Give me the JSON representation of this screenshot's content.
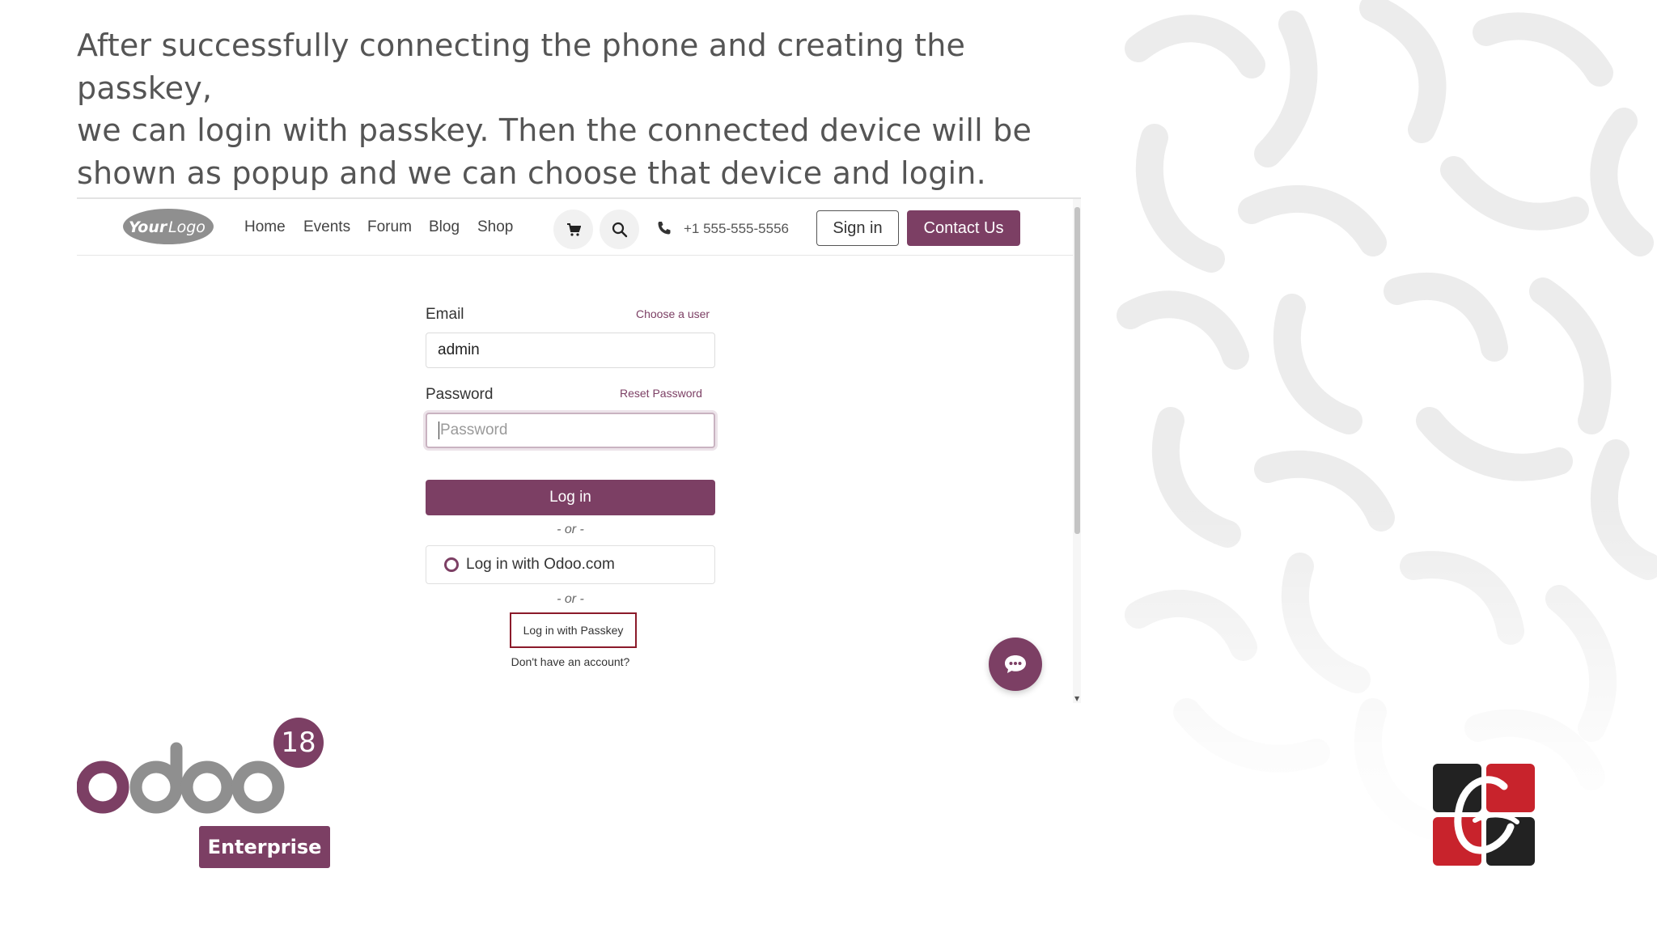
{
  "headline": {
    "line1": "After successfully connecting the phone and creating the passkey,",
    "line2": "we can login with passkey. Then the connected device will be",
    "line3": "shown as popup and we can choose that device and login."
  },
  "navbar": {
    "logo": "YourLogo",
    "links": [
      "Home",
      "Events",
      "Forum",
      "Blog",
      "Shop"
    ],
    "cart_icon": "cart-icon",
    "search_icon": "search-icon",
    "phone_icon": "phone-icon",
    "phone": "+1 555-555-5556",
    "sign_in": "Sign in",
    "contact": "Contact Us"
  },
  "login_form": {
    "email_label": "Email",
    "choose_user": "Choose a user",
    "email_value": "admin",
    "password_label": "Password",
    "reset_password": "Reset Password",
    "password_placeholder": "Password",
    "login_button": "Log in",
    "or_separator": "- or -",
    "odoo_login": "Log in with Odoo.com",
    "passkey_login": "Log in with Passkey",
    "signup": "Don't have an account?"
  },
  "chat_icon": "chat-bubble-icon",
  "branding": {
    "odoo_version": "18",
    "edition": "Enterprise"
  },
  "colors": {
    "brand_purple": "#7c3f64",
    "highlight_red": "#8b1a2a",
    "text_gray": "#555555"
  }
}
